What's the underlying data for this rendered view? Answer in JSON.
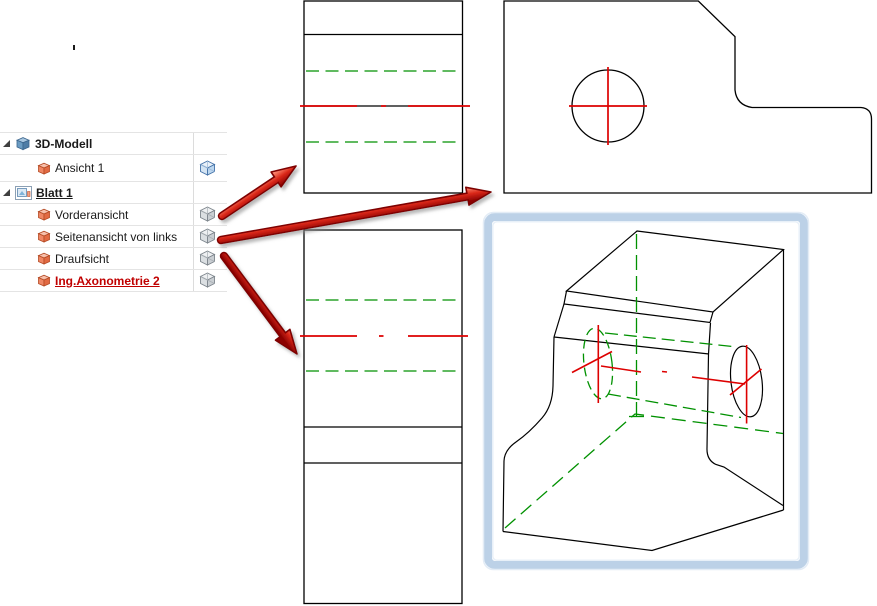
{
  "tree": {
    "rows": [
      {
        "label": "3D-Modell",
        "expanded": true
      },
      {
        "label": "Ansicht 1"
      },
      {
        "label": "Blatt 1",
        "expanded": true
      },
      {
        "label": "Vorderansicht"
      },
      {
        "label": "Seitenansicht von links"
      },
      {
        "label": "Draufsicht"
      },
      {
        "label": "Ing.Axonometrie 2",
        "selected": true
      }
    ]
  },
  "colors": {
    "visible_edge": "#000000",
    "hidden_line_green": "#009100",
    "centerline_red": "#dd0000",
    "selection_frame_blue": "#bcd1e7",
    "arrow_body_red": "#d92718",
    "arrow_outline_dark_red": "#7e0404",
    "tree_highlight_text": "#c00000",
    "row_separator": "#e4e4e4"
  }
}
